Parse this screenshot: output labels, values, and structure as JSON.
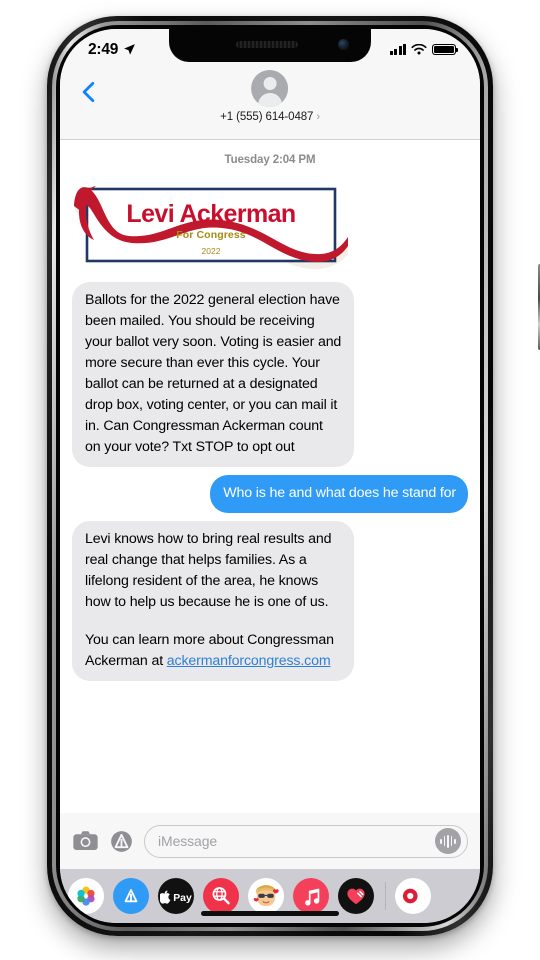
{
  "status_bar": {
    "time": "2:49",
    "location_icon": "location-arrow-icon",
    "signal_icon": "cellular-signal-icon",
    "wifi_icon": "wifi-icon",
    "battery_icon": "battery-icon"
  },
  "nav": {
    "back_icon": "back-chevron-icon",
    "avatar_icon": "contact-avatar-icon",
    "contact_name": "+1 (555) 614-0487",
    "contact_chevron": "›"
  },
  "conversation": {
    "timestamp": "Tuesday 2:04 PM",
    "banner": {
      "name": "Levi Ackerman",
      "office": "For Congress",
      "year": "2022",
      "colors": {
        "name_red": "#C8102E",
        "border_navy": "#1F3864",
        "office_gold": "#A68B12",
        "ribbon_red": "#C0182C"
      }
    },
    "messages": [
      {
        "side": "in",
        "text": "Ballots for the 2022 general election have been mailed. You should be receiving your ballot very soon. Voting is easier and more secure than ever this cycle. Your ballot can be returned at a designated drop box, voting center, or you can mail it in. Can Congressman Ackerman count on your vote? Txt STOP to opt out"
      },
      {
        "side": "out",
        "text": "Who is he and what does he stand for"
      },
      {
        "side": "in",
        "paragraph_1": "Levi knows how to bring real results and real change that helps families. As a lifelong resident of the area, he knows how to help us because he is one of us.",
        "paragraph_2_prefix": "You can learn more about Congressman Ackerman at ",
        "link_text": "ackermanforcongress.com"
      }
    ]
  },
  "input_bar": {
    "camera_icon": "camera-icon",
    "appstore_icon": "app-store-icon",
    "placeholder": "iMessage",
    "mic_icon": "audio-waveform-icon"
  },
  "app_drawer": {
    "apps": [
      {
        "name": "photos-app",
        "icon": "photos-icon",
        "bg": "#ffffff"
      },
      {
        "name": "app-store-app",
        "icon": "app-store-icon",
        "bg": "#2f9bf6"
      },
      {
        "name": "apple-pay-app",
        "icon": "apple-pay-icon",
        "bg": "#111111"
      },
      {
        "name": "images-search-app",
        "icon": "magnifier-globe-icon",
        "bg": "#f0324b"
      },
      {
        "name": "memoji-app",
        "icon": "memoji-face-icon",
        "bg": "#ffffff"
      },
      {
        "name": "music-app",
        "icon": "music-note-icon",
        "bg": "#f4405a"
      },
      {
        "name": "digital-touch-app",
        "icon": "heart-icon",
        "bg": "#111111"
      },
      {
        "name": "more-apps",
        "icon": "partial-app-icon",
        "bg": "#ffffff"
      }
    ]
  },
  "colors": {
    "ios_blue": "#2f9bf6",
    "bubble_gray": "#e9e9eb",
    "chrome_gray": "#f7f7f7",
    "drawer_gray": "#ccccd2"
  }
}
